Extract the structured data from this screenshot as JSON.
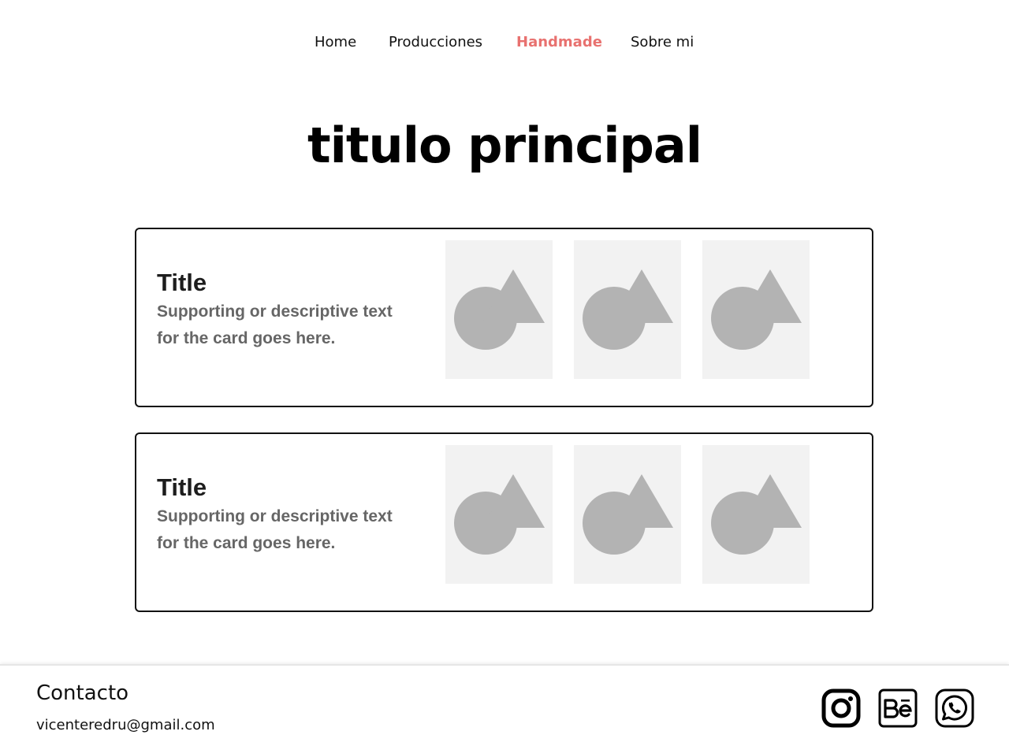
{
  "nav": {
    "items": [
      {
        "label": "Home",
        "active": false
      },
      {
        "label": "Producciones",
        "active": false
      },
      {
        "label": "Handmade",
        "active": true
      },
      {
        "label": "Sobre mi",
        "active": false
      }
    ],
    "active_color": "#e8716f"
  },
  "main": {
    "title": "titulo principal",
    "cards": [
      {
        "title": "Title",
        "description": "Supporting or descriptive text for the card goes here.",
        "images": [
          "image-placeholder-icon",
          "image-placeholder-icon",
          "image-placeholder-icon"
        ]
      },
      {
        "title": "Title",
        "description": "Supporting or descriptive text for the card goes here.",
        "images": [
          "image-placeholder-icon",
          "image-placeholder-icon",
          "image-placeholder-icon"
        ]
      }
    ]
  },
  "footer": {
    "heading": "Contacto",
    "email": "vicenteredru@gmail.com",
    "social": [
      "instagram-icon",
      "behance-icon",
      "whatsapp-icon"
    ]
  },
  "colors": {
    "accent": "#e8716f",
    "placeholder_bg": "#f2f2f2",
    "placeholder_shape": "#b3b3b3",
    "card_border": "#111111"
  }
}
